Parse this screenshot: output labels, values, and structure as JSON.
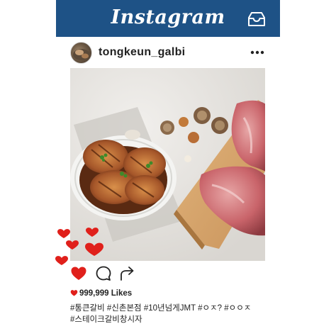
{
  "app": {
    "brand": "Instagram"
  },
  "post": {
    "username": "tongkeun_galbi",
    "likes_count": "999,999",
    "likes_label": "Likes",
    "hashtags_line1": "#통큰갈비 #신촌본점 #10년넘게JMT #ㅇㅈ? #ㅇㅇㅈ",
    "hashtags_line2": "#스테이크갈비창시자"
  },
  "icons": {
    "inbox": "inbox-icon",
    "more": "more-options-icon",
    "like": "heart-icon",
    "comment": "comment-icon",
    "share": "share-arrow-icon"
  },
  "colors": {
    "header_bg": "#1e5286",
    "heart_red": "#e0201b",
    "text": "#222222"
  }
}
